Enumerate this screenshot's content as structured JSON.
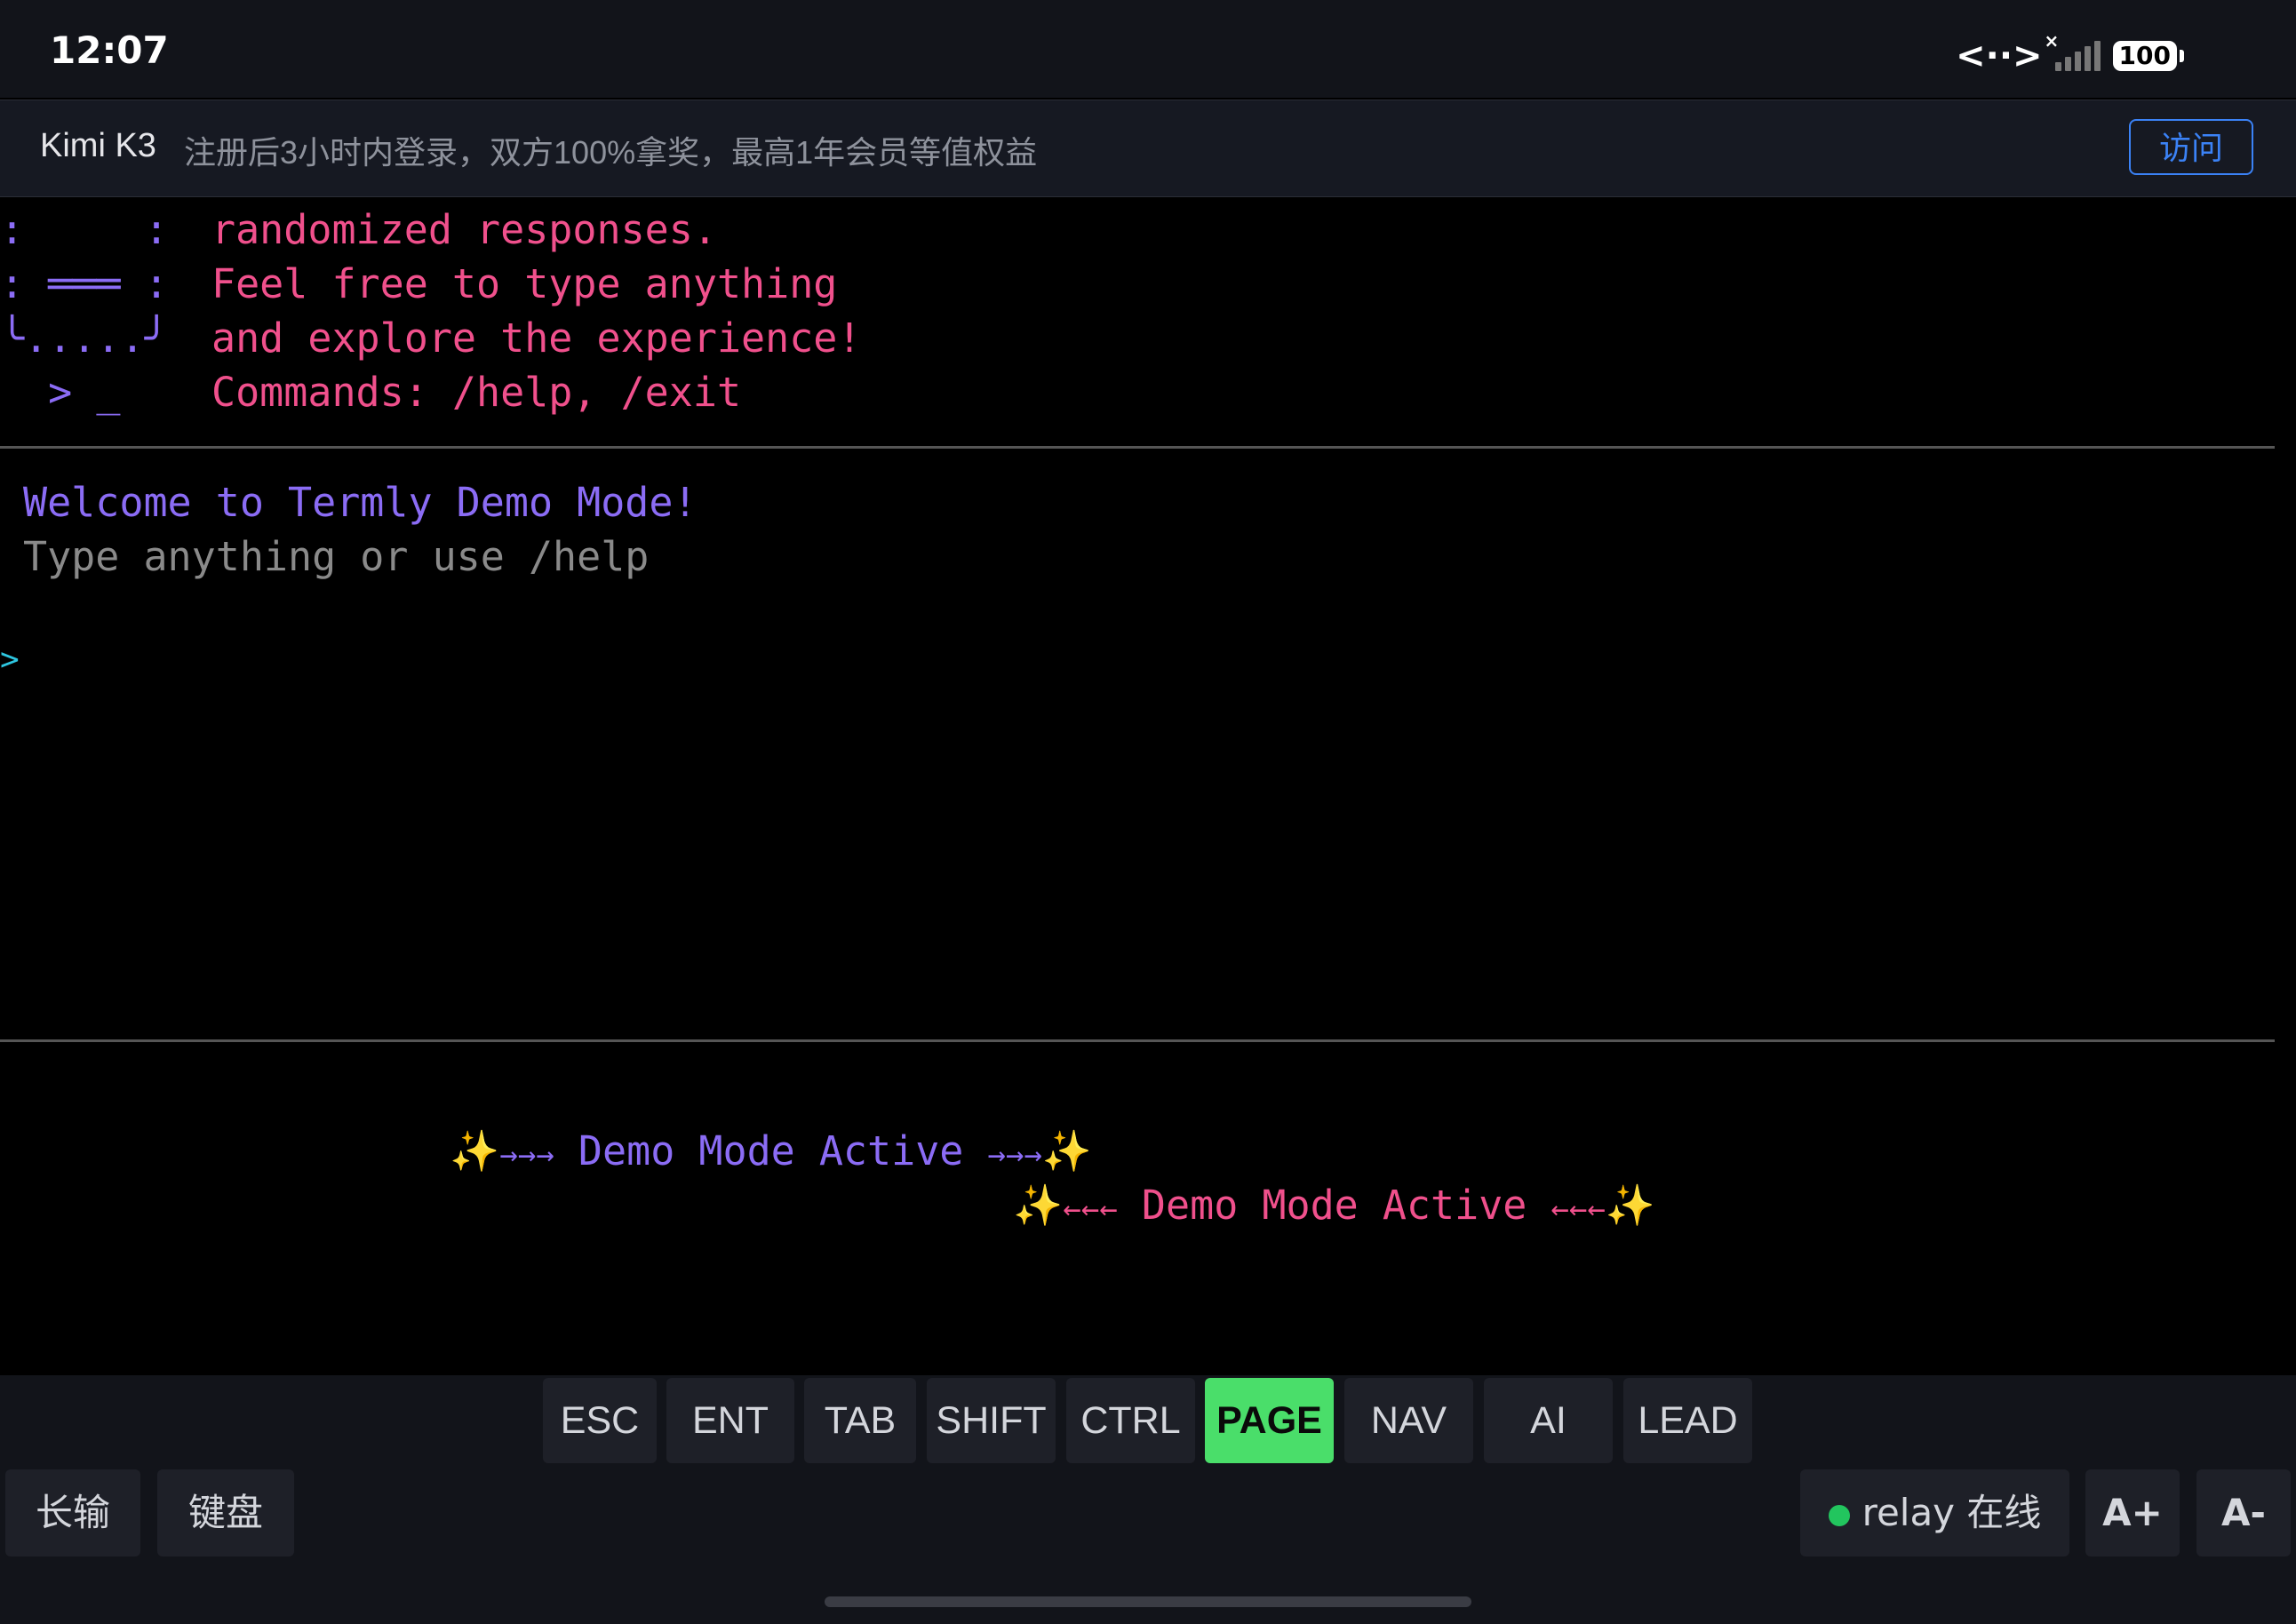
{
  "status_bar": {
    "time": "12:07",
    "data_icon": "<··>",
    "signal_mark": "×",
    "battery": "100"
  },
  "banner": {
    "title": "Kimi K3",
    "text": "注册后3小时内登录，双方100%拿奖，最高1年会员等值权益",
    "visit_label": "访问"
  },
  "terminal": {
    "ascii_art": [
      ":     :",
      ": ═══ :",
      "╰.....╯",
      "  > _"
    ],
    "intro_lines": [
      "randomized responses.",
      "Feel free to type anything",
      "and explore the experience!",
      "Commands: /help, /exit"
    ],
    "welcome": "Welcome to Termly Demo Mode!",
    "hint": "Type anything or use /help",
    "prompt": ">",
    "banner_line_1": {
      "sparkle_left": "✨",
      "arrows_left": "→→→",
      "text": "Demo Mode Active",
      "arrows_right": "→→→",
      "sparkle_right": "✨"
    },
    "banner_line_2": {
      "sparkle_left": "✨",
      "arrows_left": "←←←",
      "text": "Demo Mode Active",
      "arrows_right": "←←←",
      "sparkle_right": "✨"
    }
  },
  "toolbar": {
    "keys": [
      "ESC",
      "ENT",
      "TAB",
      "SHIFT",
      "CTRL",
      "PAGE",
      "NAV",
      "AI",
      "LEAD"
    ],
    "active_key": "PAGE",
    "long_input": "长输",
    "keyboard": "键盘",
    "relay_status": "relay 在线",
    "font_increase": "A+",
    "font_decrease": "A-"
  },
  "colors": {
    "accent_pink": "#f0508c",
    "accent_purple": "#8b6cf5",
    "active_key": "#4ade6a",
    "link_blue": "#3b82f6",
    "online_green": "#22c55e"
  }
}
